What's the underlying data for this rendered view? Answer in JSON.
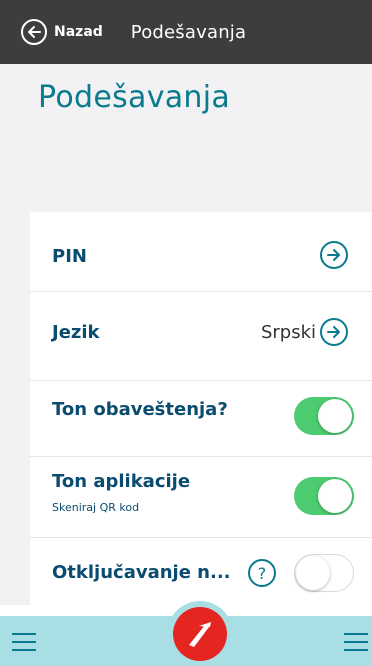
{
  "topbar": {
    "back_label": "Nazad",
    "title": "Podešavanja"
  },
  "header": {
    "title": "Podešavanja"
  },
  "settings": [
    {
      "id": "pin",
      "label": "PIN",
      "control": "arrow"
    },
    {
      "id": "jezik",
      "label": "Jezik",
      "value": "Srpski",
      "control": "arrow"
    },
    {
      "id": "ton-obavestenja",
      "label": "Ton obaveštenja?",
      "control": "toggle",
      "on": true
    },
    {
      "id": "ton-aplikacije",
      "label": "Ton aplikacije",
      "sublabel": "Skeniraj QR kod",
      "control": "toggle",
      "on": true
    },
    {
      "id": "otkljucavanje",
      "label": "Otključavanje n...",
      "control": "toggle",
      "on": false,
      "help": "?"
    }
  ],
  "colors": {
    "accent": "#0a7b8d",
    "label": "#0a4c70",
    "toggle_on": "#4ccb70",
    "topbar": "#3d3d3d",
    "bottombar": "#a9dfe4",
    "brand": "#e52520"
  },
  "icons": {
    "back": "arrow-left-circle-icon",
    "row_arrow": "arrow-right-circle-icon",
    "help": "question-circle-icon",
    "menu": "hamburger-menu-icon",
    "logo": "bank-logo-icon"
  }
}
